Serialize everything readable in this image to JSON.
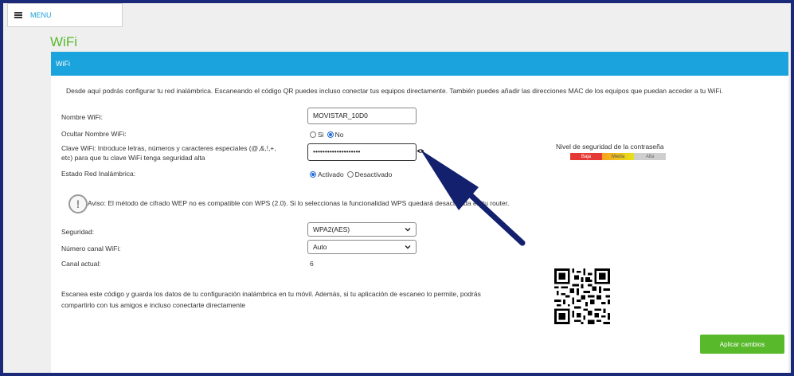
{
  "menu": {
    "label": "MENU"
  },
  "page": {
    "title": "WiFi"
  },
  "card": {
    "header": "WiFi",
    "description": "Desde aquí podrás configurar tu red inalámbrica. Escaneando el código QR puedes incluso conectar tus equipos directamente. También puedes añadir las direcciones MAC de los equipos que puedan acceder a tu WiFi."
  },
  "form": {
    "ssid_label": "Nombre WiFi:",
    "ssid_value": "MOVISTAR_10D0",
    "hide_label": "Ocultar Nombre WiFi:",
    "hide_options": [
      "Si",
      "No"
    ],
    "hide_selected": "No",
    "password_label_1": "Clave WiFi: Introduce letras, números y caracteres especiales (@,&,!,+,",
    "password_label_2": "etc) para que tu clave WiFi tenga seguridad alta",
    "password_value": "••••••••••••••••••••",
    "strength_title": "Nivel de seguridad de la contraseña",
    "strength_levels": [
      "Baja",
      "Media",
      "Alta"
    ],
    "state_label": "Estado Red Inalámbrica:",
    "state_options": [
      "Activado",
      "Desactivado"
    ],
    "state_selected": "Activado",
    "warning": "Aviso: El método de cifrado WEP no es compatible con WPS (2.0). Si lo seleccionas la funcionalidad WPS quedará desactivada en tu router.",
    "security_label": "Seguridad:",
    "security_value": "WPA2(AES)",
    "channel_label": "Número canal WiFi:",
    "channel_value": "Auto",
    "current_channel_label": "Canal actual:",
    "current_channel_value": "6",
    "qr_text_1": "Escanea este código y guarda los datos de tu configuración inalámbrica en tu móvil. Además, si tu aplicación de escaneo lo permite, podrás",
    "qr_text_2": "compartirlo con tus amigos e incluso conectarte directamente",
    "apply_label": "Aplicar cambios"
  },
  "colors": {
    "accent_blue": "#1aa3dc",
    "accent_green": "#58b92b",
    "annotation_arrow": "#13206e"
  }
}
